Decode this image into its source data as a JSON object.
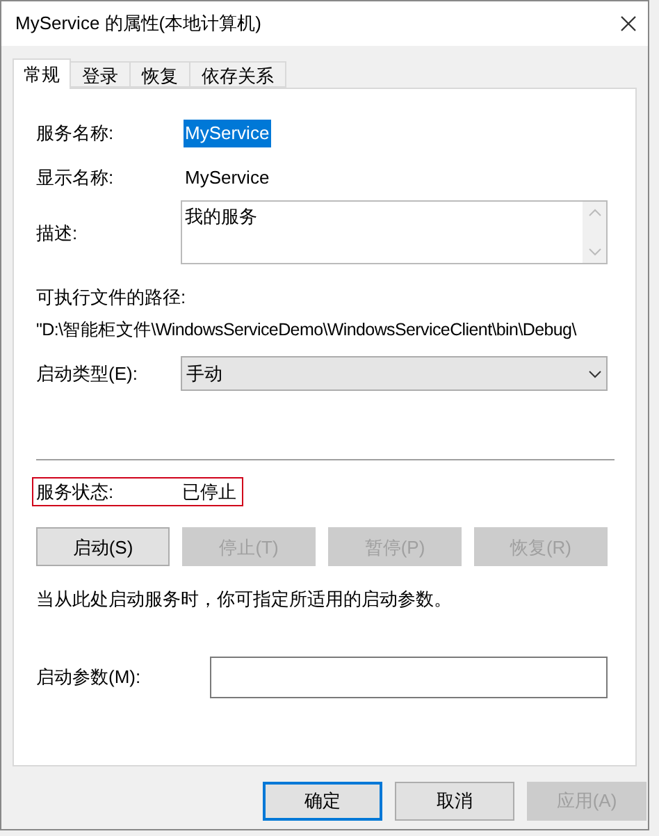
{
  "window": {
    "title": "MyService 的属性(本地计算机)"
  },
  "tabs": [
    {
      "label": "常规",
      "selected": true
    },
    {
      "label": "登录",
      "selected": false
    },
    {
      "label": "恢复",
      "selected": false
    },
    {
      "label": "依存关系",
      "selected": false
    }
  ],
  "service_name": {
    "label": "服务名称:",
    "value": "MyService",
    "selected": true
  },
  "display_name": {
    "label": "显示名称:",
    "value": "MyService"
  },
  "description": {
    "label": "描述:",
    "value": "我的服务"
  },
  "path": {
    "label": "可执行文件的路径:",
    "value": "\"D:\\智能柜文件\\WindowsServiceDemo\\WindowsServiceClient\\bin\\Debug\\"
  },
  "startup_type": {
    "label": "启动类型(E):",
    "value": "手动"
  },
  "status": {
    "label": "服务状态:",
    "value": "已停止",
    "highlighted": true
  },
  "service_buttons": [
    {
      "label": "启动(S)",
      "disabled": false
    },
    {
      "label": "停止(T)",
      "disabled": true
    },
    {
      "label": "暂停(P)",
      "disabled": true
    },
    {
      "label": "恢复(R)",
      "disabled": true
    }
  ],
  "hint": "当从此处启动服务时，你可指定所适用的启动参数。",
  "start_params": {
    "label": "启动参数(M):"
  },
  "dialog_buttons": [
    {
      "label": "确定",
      "disabled": false,
      "default": true
    },
    {
      "label": "取消",
      "disabled": false,
      "default": false
    },
    {
      "label": "应用(A)",
      "disabled": true,
      "default": false
    }
  ]
}
